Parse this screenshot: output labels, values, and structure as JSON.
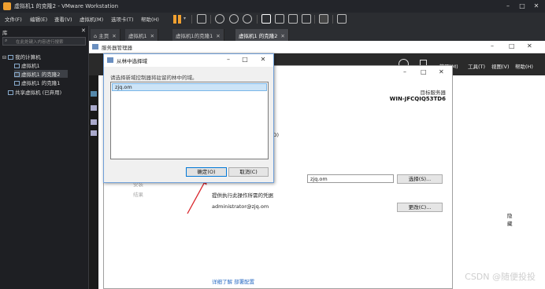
{
  "vmware": {
    "title": "虚拟机1 的克隆2 - VMware Workstation",
    "menu": [
      "文件(F)",
      "编辑(E)",
      "查看(V)",
      "虚拟机(M)",
      "选项卡(T)",
      "帮助(H)"
    ]
  },
  "library": {
    "title": "库",
    "search_placeholder": "在此处键入内容进行搜索",
    "tree": {
      "my_computer": "我的计算机",
      "vms": [
        "虚拟机1",
        "虚拟机1 的克隆2",
        "虚拟机1 的克隆1"
      ],
      "shared": "共享虚拟机 (已弃用)"
    }
  },
  "tabs": [
    "主页",
    "虚拟机1",
    "虚拟机1的克隆1",
    "虚拟机1 的克隆2"
  ],
  "server_manager": {
    "title": "服务器管理器",
    "menus": [
      "管理(M)",
      "工具(T)",
      "视图(V)",
      "帮助(H)"
    ]
  },
  "wizard": {
    "dest_label": "目标服务器",
    "dest_name": "WIN-JFCQIQ53TD6",
    "partial_label": "(D)",
    "domain_value": "zjq.om",
    "select_button": "选择(S)...",
    "cred_label": "提供执行此操作所需的凭据",
    "cred_user": "administrator@zjq.om",
    "change_button": "更改(C)...",
    "hide_label": "隐藏",
    "more_link": "详细了解 部署配置",
    "faded_items": [
      "安装",
      "结果"
    ]
  },
  "dialog": {
    "title": "从林中选择域",
    "instruction": "请选择新域控制器将驻留的林中的域。",
    "domains": [
      "zjq.om"
    ],
    "ok_button": "确定(O)",
    "cancel_button": "取消(C)"
  },
  "watermark": "CSDN @随便投投"
}
